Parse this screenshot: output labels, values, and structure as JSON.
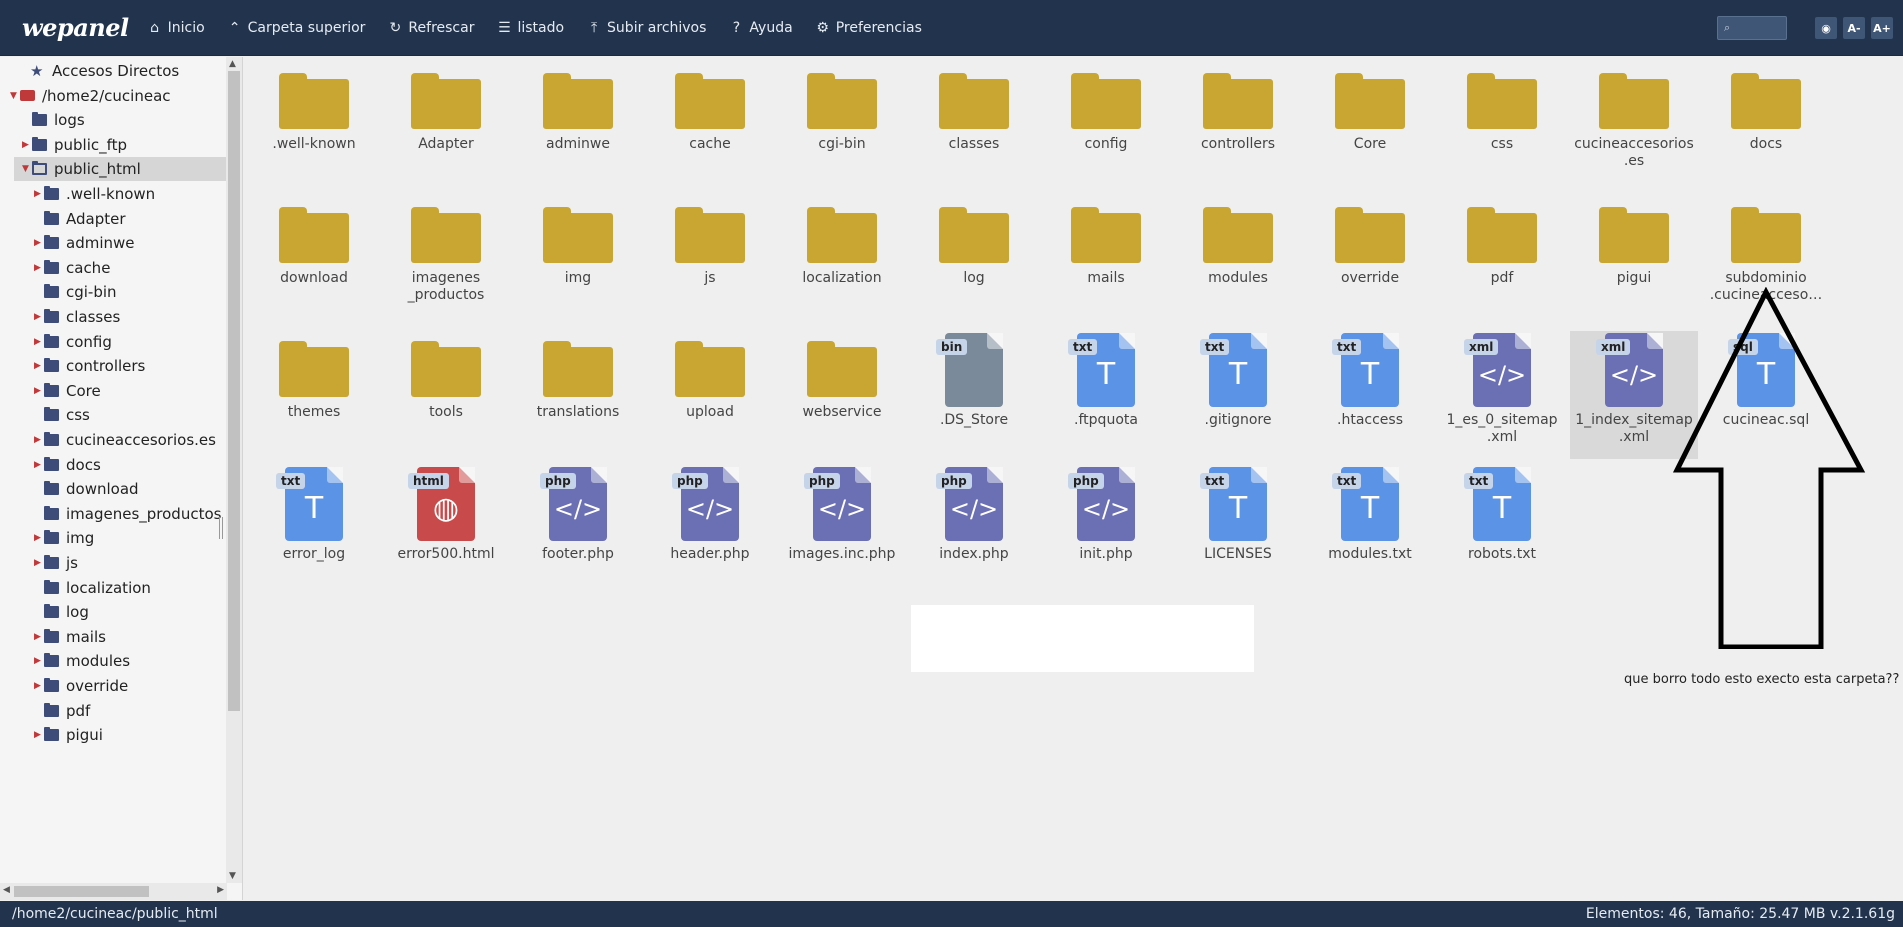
{
  "app": {
    "logo": "wepanel"
  },
  "menu": [
    {
      "label": "Inicio",
      "icon": "home-icon",
      "glyph": "⌂"
    },
    {
      "label": "Carpeta superior",
      "icon": "chevron-up-icon",
      "glyph": "⌃"
    },
    {
      "label": "Refrescar",
      "icon": "refresh-icon",
      "glyph": "↻"
    },
    {
      "label": "listado",
      "icon": "list-icon",
      "glyph": "☰"
    },
    {
      "label": "Subir archivos",
      "icon": "upload-icon",
      "glyph": "⤒"
    },
    {
      "label": "Ayuda",
      "icon": "help-icon",
      "glyph": "?"
    },
    {
      "label": "Preferencias",
      "icon": "sliders-icon",
      "glyph": "⚙"
    }
  ],
  "toolbar_right": {
    "search_glyph": "⌕",
    "view_glyph": "◉",
    "font_decrease": "A-",
    "font_increase": "A+"
  },
  "tree": [
    {
      "label": "Accesos Directos",
      "icon": "star",
      "depth": 0,
      "arrow": ""
    },
    {
      "label": "/home2/cucineac",
      "icon": "drive",
      "depth": 0,
      "arrow": "▼"
    },
    {
      "label": "logs",
      "icon": "folder",
      "depth": 1,
      "arrow": ""
    },
    {
      "label": "public_ftp",
      "icon": "folder",
      "depth": 1,
      "arrow": "▶"
    },
    {
      "label": "public_html",
      "icon": "open",
      "depth": 1,
      "arrow": "▼",
      "selected": true
    },
    {
      "label": ".well-known",
      "icon": "folder",
      "depth": 2,
      "arrow": "▶"
    },
    {
      "label": "Adapter",
      "icon": "folder",
      "depth": 2,
      "arrow": ""
    },
    {
      "label": "adminwe",
      "icon": "folder",
      "depth": 2,
      "arrow": "▶"
    },
    {
      "label": "cache",
      "icon": "folder",
      "depth": 2,
      "arrow": "▶"
    },
    {
      "label": "cgi-bin",
      "icon": "folder",
      "depth": 2,
      "arrow": ""
    },
    {
      "label": "classes",
      "icon": "folder",
      "depth": 2,
      "arrow": "▶"
    },
    {
      "label": "config",
      "icon": "folder",
      "depth": 2,
      "arrow": "▶"
    },
    {
      "label": "controllers",
      "icon": "folder",
      "depth": 2,
      "arrow": "▶"
    },
    {
      "label": "Core",
      "icon": "folder",
      "depth": 2,
      "arrow": "▶"
    },
    {
      "label": "css",
      "icon": "folder",
      "depth": 2,
      "arrow": ""
    },
    {
      "label": "cucineaccesorios.es",
      "icon": "folder",
      "depth": 2,
      "arrow": "▶"
    },
    {
      "label": "docs",
      "icon": "folder",
      "depth": 2,
      "arrow": "▶"
    },
    {
      "label": "download",
      "icon": "folder",
      "depth": 2,
      "arrow": ""
    },
    {
      "label": "imagenes_productos",
      "icon": "folder",
      "depth": 2,
      "arrow": ""
    },
    {
      "label": "img",
      "icon": "folder",
      "depth": 2,
      "arrow": "▶"
    },
    {
      "label": "js",
      "icon": "folder",
      "depth": 2,
      "arrow": "▶"
    },
    {
      "label": "localization",
      "icon": "folder",
      "depth": 2,
      "arrow": ""
    },
    {
      "label": "log",
      "icon": "folder",
      "depth": 2,
      "arrow": ""
    },
    {
      "label": "mails",
      "icon": "folder",
      "depth": 2,
      "arrow": "▶"
    },
    {
      "label": "modules",
      "icon": "folder",
      "depth": 2,
      "arrow": "▶"
    },
    {
      "label": "override",
      "icon": "folder",
      "depth": 2,
      "arrow": "▶"
    },
    {
      "label": "pdf",
      "icon": "folder",
      "depth": 2,
      "arrow": ""
    },
    {
      "label": "pigui",
      "icon": "folder",
      "depth": 2,
      "arrow": "▶"
    }
  ],
  "scroll_glyphs": {
    "up": "▲",
    "down": "▼",
    "left": "◀",
    "right": "▶"
  },
  "items": [
    {
      "name": ".well-known",
      "type": "folder"
    },
    {
      "name": "Adapter",
      "type": "folder"
    },
    {
      "name": "adminwe",
      "type": "folder"
    },
    {
      "name": "cache",
      "type": "folder"
    },
    {
      "name": "cgi-bin",
      "type": "folder"
    },
    {
      "name": "classes",
      "type": "folder"
    },
    {
      "name": "config",
      "type": "folder"
    },
    {
      "name": "controllers",
      "type": "folder"
    },
    {
      "name": "Core",
      "type": "folder"
    },
    {
      "name": "css",
      "type": "folder"
    },
    {
      "name": "cucineaccesorios\n.es",
      "type": "folder"
    },
    {
      "name": "docs",
      "type": "folder"
    },
    {
      "name": "download",
      "type": "folder"
    },
    {
      "name": "imagenes\n_productos",
      "type": "folder"
    },
    {
      "name": "img",
      "type": "folder"
    },
    {
      "name": "js",
      "type": "folder"
    },
    {
      "name": "localization",
      "type": "folder"
    },
    {
      "name": "log",
      "type": "folder"
    },
    {
      "name": "mails",
      "type": "folder"
    },
    {
      "name": "modules",
      "type": "folder"
    },
    {
      "name": "override",
      "type": "folder"
    },
    {
      "name": "pdf",
      "type": "folder"
    },
    {
      "name": "pigui",
      "type": "folder"
    },
    {
      "name": "subdominio\n.cucineacceso…",
      "type": "folder"
    },
    {
      "name": "themes",
      "type": "folder"
    },
    {
      "name": "tools",
      "type": "folder"
    },
    {
      "name": "translations",
      "type": "folder"
    },
    {
      "name": "upload",
      "type": "folder"
    },
    {
      "name": "webservice",
      "type": "folder"
    },
    {
      "name": ".DS_Store",
      "type": "file",
      "ext": "bin",
      "color": "#7a8a9a",
      "glyph": ""
    },
    {
      "name": ".ftpquota",
      "type": "file",
      "ext": "txt",
      "color": "#5b93e6",
      "glyph": "T"
    },
    {
      "name": ".gitignore",
      "type": "file",
      "ext": "txt",
      "color": "#5b93e6",
      "glyph": "T"
    },
    {
      "name": ".htaccess",
      "type": "file",
      "ext": "txt",
      "color": "#5b93e6",
      "glyph": "T"
    },
    {
      "name": "1_es_0_sitemap\n.xml",
      "type": "file",
      "ext": "xml",
      "color": "#6b6fb3",
      "glyph": "</>"
    },
    {
      "name": "1_index_sitemap\n.xml",
      "type": "file",
      "ext": "xml",
      "color": "#6b6fb3",
      "glyph": "</>",
      "selected": true
    },
    {
      "name": "cucineac.sql",
      "type": "file",
      "ext": "sql",
      "color": "#5b93e6",
      "glyph": "T"
    },
    {
      "name": "error_log",
      "type": "file",
      "ext": "txt",
      "color": "#5b93e6",
      "glyph": "T"
    },
    {
      "name": "error500.html",
      "type": "file",
      "ext": "html",
      "color": "#c94a4a",
      "glyph": "◍"
    },
    {
      "name": "footer.php",
      "type": "file",
      "ext": "php",
      "color": "#6b6fb3",
      "glyph": "</>"
    },
    {
      "name": "header.php",
      "type": "file",
      "ext": "php",
      "color": "#6b6fb3",
      "glyph": "</>"
    },
    {
      "name": "images.inc.php",
      "type": "file",
      "ext": "php",
      "color": "#6b6fb3",
      "glyph": "</>"
    },
    {
      "name": "index.php",
      "type": "file",
      "ext": "php",
      "color": "#6b6fb3",
      "glyph": "</>"
    },
    {
      "name": "init.php",
      "type": "file",
      "ext": "php",
      "color": "#6b6fb3",
      "glyph": "</>"
    },
    {
      "name": "LICENSES",
      "type": "file",
      "ext": "txt",
      "color": "#5b93e6",
      "glyph": "T"
    },
    {
      "name": "modules.txt",
      "type": "file",
      "ext": "txt",
      "color": "#5b93e6",
      "glyph": "T"
    },
    {
      "name": "robots.txt",
      "type": "file",
      "ext": "txt",
      "color": "#5b93e6",
      "glyph": "T"
    }
  ],
  "annotation": {
    "text": "que borro todo esto execto esta carpeta??"
  },
  "status": {
    "path": "/home2/cucineac/public_html",
    "summary": "Elementos: 46, Tamaño: 25.47 MB v.2.1.61g"
  }
}
